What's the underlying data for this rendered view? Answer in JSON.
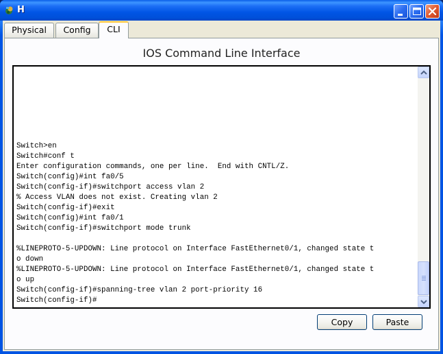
{
  "window": {
    "title": "H",
    "icon": "packet-tracer-device-icon",
    "controls": {
      "minimize": "minimize-icon",
      "maximize": "maximize-icon",
      "close": "close-icon"
    }
  },
  "tabs": [
    {
      "label": "Physical",
      "active": false
    },
    {
      "label": "Config",
      "active": false
    },
    {
      "label": "CLI",
      "active": true
    }
  ],
  "panel": {
    "title": "IOS Command Line Interface"
  },
  "terminal": {
    "lines": [
      "Switch>en",
      "Switch#conf t",
      "Enter configuration commands, one per line.  End with CNTL/Z.",
      "Switch(config)#int fa0/5",
      "Switch(config-if)#switchport access vlan 2",
      "% Access VLAN does not exist. Creating vlan 2",
      "Switch(config-if)#exit",
      "Switch(config)#int fa0/1",
      "Switch(config-if)#switchport mode trunk",
      "",
      "%LINEPROTO-5-UPDOWN: Line protocol on Interface FastEthernet0/1, changed state t",
      "o down",
      "%LINEPROTO-5-UPDOWN: Line protocol on Interface FastEthernet0/1, changed state t",
      "o up",
      "Switch(config-if)#spanning-tree vlan 2 port-priority 16",
      "Switch(config-if)#"
    ],
    "scroll_position": "bottom"
  },
  "buttons": {
    "copy": "Copy",
    "paste": "Paste"
  }
}
